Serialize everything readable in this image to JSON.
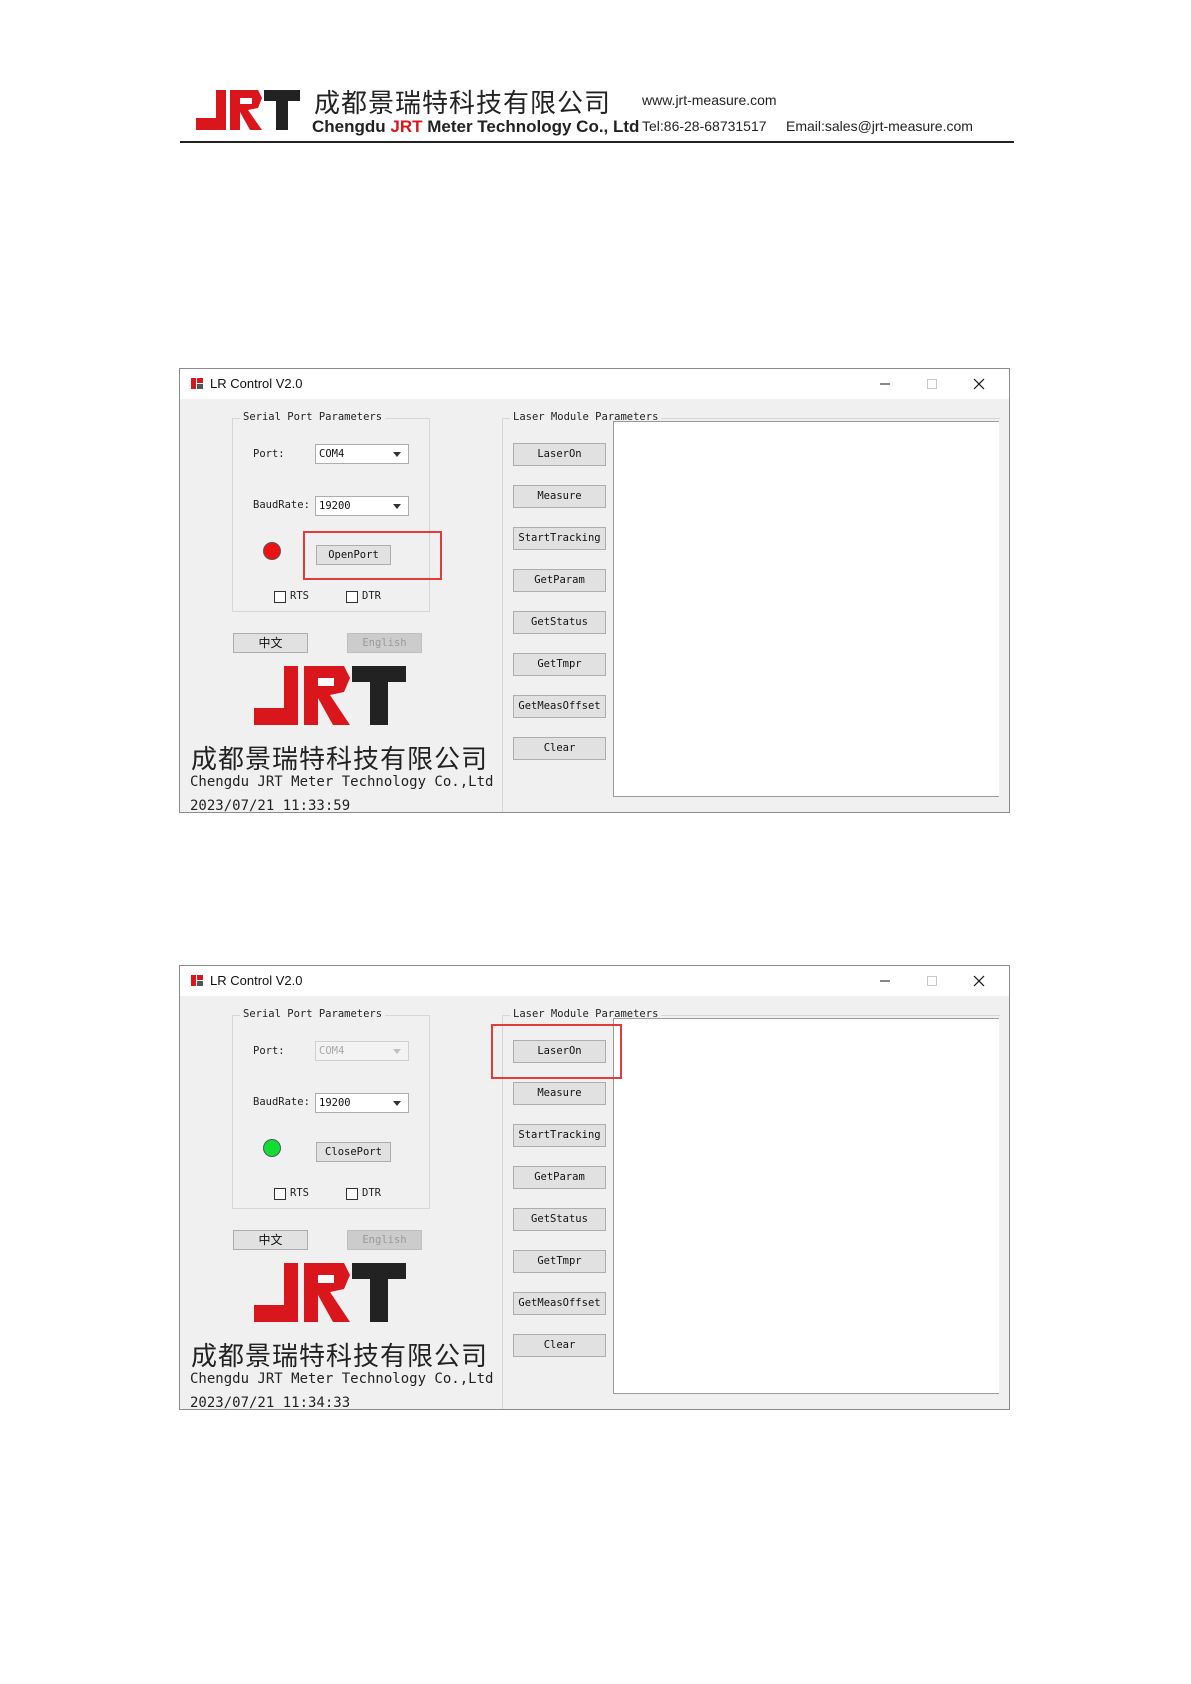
{
  "header": {
    "logo_text": "JRT",
    "company_cn": "成都景瑞特科技有限公司",
    "company_en_prefix": "Chengdu ",
    "company_en_brand": "JRT",
    "company_en_suffix": " Meter Technology Co., Ltd",
    "website": "www.jrt-measure.com",
    "tel": "Tel:86-28-68731517",
    "email": "Email:sales@jrt-measure.com"
  },
  "windows": [
    {
      "title": "LR Control V2.0",
      "serial_group_label": "Serial Port Parameters",
      "port_label": "Port:",
      "port_value": "COM4",
      "port_disabled": false,
      "baud_label": "BaudRate:",
      "baud_value": "19200",
      "status_color": "#ee1111",
      "port_button_label": "OpenPort",
      "rts_label": "RTS",
      "dtr_label": "DTR",
      "lang_cn_label": "中文",
      "lang_en_label": "English",
      "laser_group_label": "Laser Module Parameters",
      "laser_buttons": [
        "LaserOn",
        "Measure",
        "StartTracking",
        "GetParam",
        "GetStatus",
        "GetTmpr",
        "GetMeasOffset",
        "Clear"
      ],
      "company_cn": "成都景瑞特科技有限公司",
      "company_en": "Chengdu JRT Meter Technology Co.,Ltd",
      "datetime": "2023/07/21 11:33:59",
      "highlighted": "port-button"
    },
    {
      "title": "LR Control V2.0",
      "serial_group_label": "Serial Port Parameters",
      "port_label": "Port:",
      "port_value": "COM4",
      "port_disabled": true,
      "baud_label": "BaudRate:",
      "baud_value": "19200",
      "status_color": "#11dd33",
      "port_button_label": "ClosePort",
      "rts_label": "RTS",
      "dtr_label": "DTR",
      "lang_cn_label": "中文",
      "lang_en_label": "English",
      "laser_group_label": "Laser Module Parameters",
      "laser_buttons": [
        "LaserOn",
        "Measure",
        "StartTracking",
        "GetParam",
        "GetStatus",
        "GetTmpr",
        "GetMeasOffset",
        "Clear"
      ],
      "company_cn": "成都景瑞特科技有限公司",
      "company_en": "Chengdu JRT Meter Technology Co.,Ltd",
      "datetime": "2023/07/21 11:34:33",
      "highlighted": "laser-on-button"
    }
  ],
  "colors": {
    "brand_red": "#d8161b",
    "brand_dark": "#222222",
    "highlight": "#e23b3b"
  }
}
